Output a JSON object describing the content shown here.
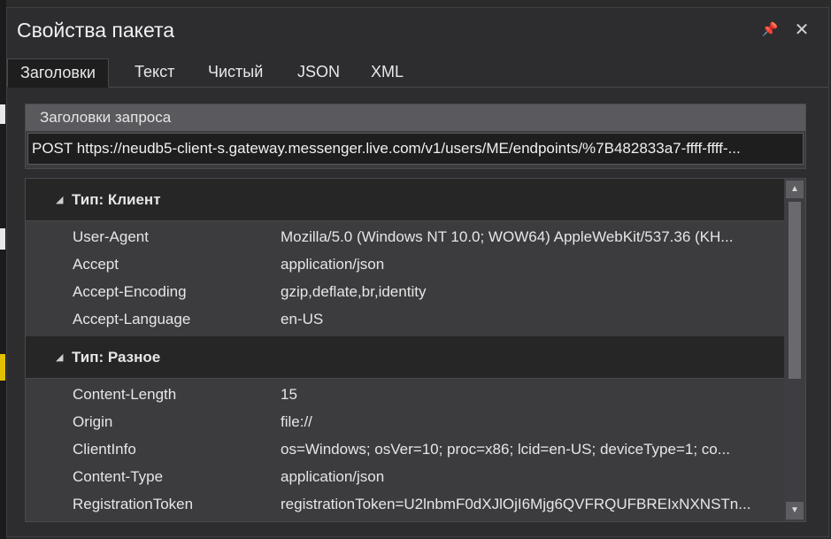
{
  "window": {
    "title": "Свойства пакета",
    "pin_icon": "pin-icon",
    "close_icon": "close-icon"
  },
  "tabs": [
    {
      "label": "Заголовки",
      "active": true
    },
    {
      "label": "Текст",
      "active": false
    },
    {
      "label": "Чистый",
      "active": false
    },
    {
      "label": "JSON",
      "active": false
    },
    {
      "label": "XML",
      "active": false
    }
  ],
  "request": {
    "header": "Заголовки запроса",
    "line": "POST https://neudb5-client-s.gateway.messenger.live.com/v1/users/ME/endpoints/%7B482833a7-ffff-ffff-..."
  },
  "categories": [
    {
      "label": "Тип: Клиент",
      "rows": [
        {
          "key": "User-Agent",
          "value": "Mozilla/5.0 (Windows NT 10.0; WOW64) AppleWebKit/537.36 (KH..."
        },
        {
          "key": "Accept",
          "value": "application/json"
        },
        {
          "key": "Accept-Encoding",
          "value": "gzip,deflate,br,identity"
        },
        {
          "key": "Accept-Language",
          "value": "en-US"
        }
      ]
    },
    {
      "label": "Тип: Разное",
      "rows": [
        {
          "key": "Content-Length",
          "value": "15"
        },
        {
          "key": "Origin",
          "value": "file://"
        },
        {
          "key": "ClientInfo",
          "value": "os=Windows; osVer=10; proc=x86; lcid=en-US; deviceType=1; co..."
        },
        {
          "key": "Content-Type",
          "value": "application/json"
        },
        {
          "key": "RegistrationToken",
          "value": "registrationToken=U2lnbmF0dXJlOjI6Mjg6QVFRQUFBREIxNXNSTn..."
        }
      ]
    }
  ],
  "colors": {
    "background": "#2d2d30",
    "category_bg": "#262626",
    "grid_bg": "#3c3c3f",
    "request_header_bg": "#5a5a5e"
  }
}
